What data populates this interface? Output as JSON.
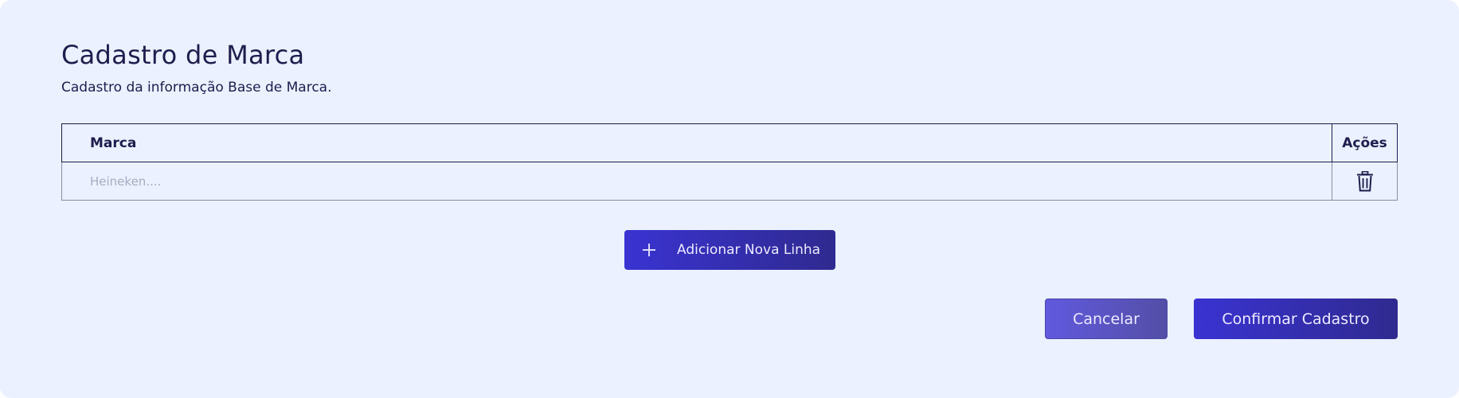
{
  "form": {
    "title": "Cadastro de Marca",
    "subtitle": "Cadastro da informação Base de Marca."
  },
  "table": {
    "columns": [
      "Marca",
      "Ações"
    ],
    "rows": [
      {
        "marca_value": "",
        "marca_placeholder": "Heineken....",
        "action_icon": "trash-icon"
      }
    ]
  },
  "actions": {
    "add_row_label": "Adicionar Nova Linha",
    "add_row_icon": "plus-icon",
    "cancel_label": "Cancelar",
    "confirm_label": "Confirmar Cadastro"
  },
  "colors": {
    "background": "#ebf1fe",
    "text": "#1f1d4d",
    "primary": "#3a33d2",
    "primary_dark": "#2f2a8f",
    "secondary": "#6159de"
  }
}
